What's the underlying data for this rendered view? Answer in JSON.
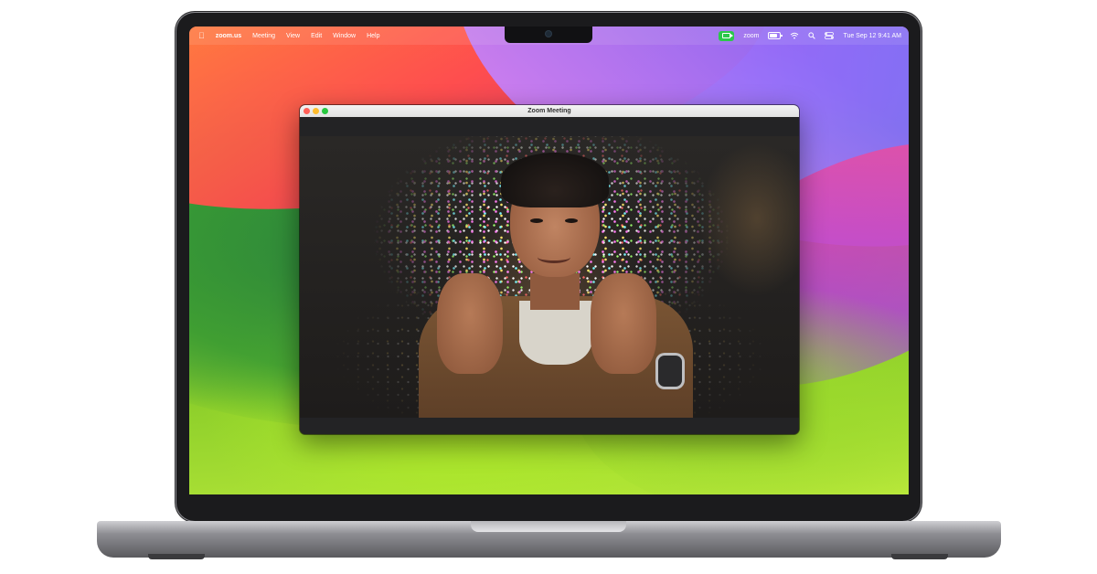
{
  "menu_bar": {
    "app_name": "zoom.us",
    "items": [
      "Meeting",
      "View",
      "Edit",
      "Window",
      "Help"
    ],
    "status_app": "zoom",
    "datetime": "Tue Sep 12  9:41 AM"
  },
  "zoom_window": {
    "title": "Zoom Meeting"
  },
  "icons": {
    "apple": "apple-icon",
    "zoom_status": "video-camera-icon",
    "battery": "battery-icon",
    "wifi": "wifi-icon",
    "search": "search-icon",
    "control_center": "control-center-icon"
  },
  "colors": {
    "zoom_green": "#2bc84a",
    "close": "#ff5f57",
    "minimize": "#febc2e",
    "maximize": "#28c840"
  }
}
